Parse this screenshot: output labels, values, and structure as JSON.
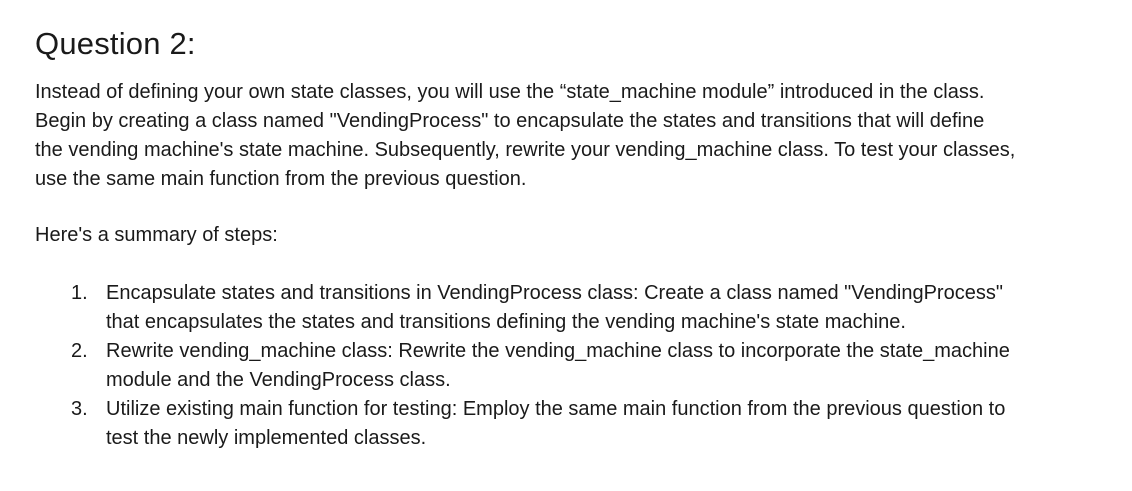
{
  "title": "Question 2:",
  "intro_lines": [
    "Instead of defining your own state classes, you will use the “state_machine module” introduced in the class.",
    "Begin by creating a class named \"VendingProcess\" to encapsulate the states and transitions that will define",
    "the vending machine's state machine. Subsequently, rewrite your vending_machine class. To test your classes,",
    "use the same main function from the previous question."
  ],
  "summary_label": "Here's a summary of steps:",
  "steps": [
    {
      "number": "1.",
      "lines": [
        "Encapsulate states and transitions in VendingProcess class: Create a class named \"VendingProcess\"",
        "that encapsulates the states and transitions defining the vending machine's state machine."
      ]
    },
    {
      "number": "2.",
      "lines": [
        "Rewrite vending_machine class: Rewrite the vending_machine class to incorporate the state_machine",
        "module and the VendingProcess class."
      ]
    },
    {
      "number": "3.",
      "lines": [
        "Utilize existing main function for testing: Employ the same main function from the previous question to",
        "test the newly implemented classes."
      ]
    }
  ]
}
